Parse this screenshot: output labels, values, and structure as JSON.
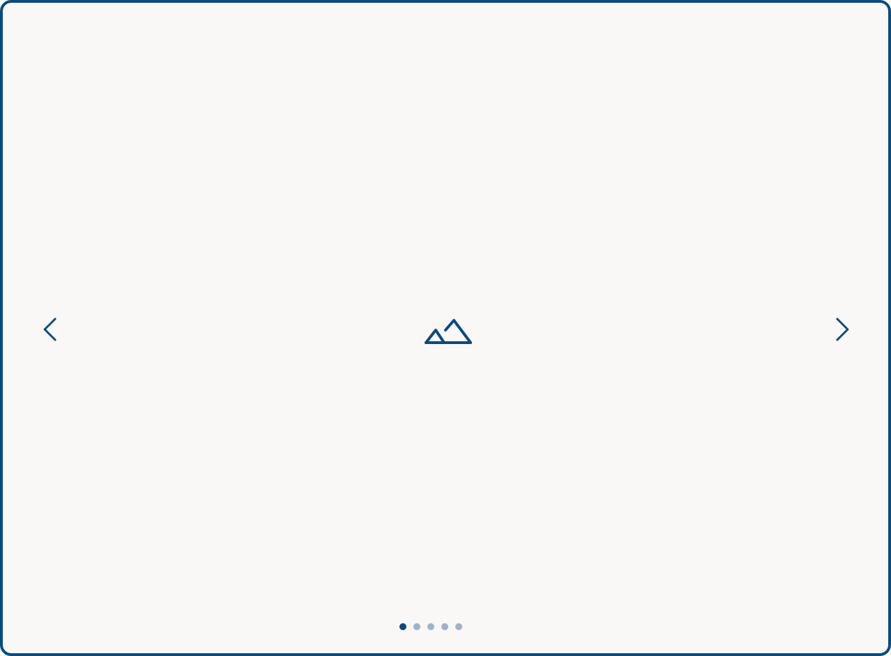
{
  "carousel": {
    "accent_color": "#0a4b80",
    "inactive_dot_color": "#9db3c9",
    "background_color": "#f9f8f7",
    "prev_icon": "chevron-left-icon",
    "next_icon": "chevron-right-icon",
    "placeholder_icon": "image-placeholder-icon",
    "slide_count": 5,
    "active_slide": 1
  }
}
